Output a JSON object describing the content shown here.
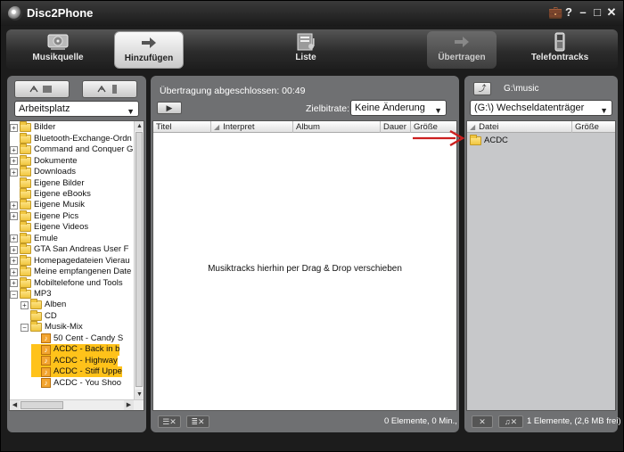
{
  "window": {
    "title": "Disc2Phone",
    "controls": [
      "💼",
      "?",
      "–",
      "□",
      "✕"
    ]
  },
  "toolbar": {
    "tools": [
      {
        "label": "Musikquelle"
      },
      {
        "label": "Hinzufügen"
      },
      {
        "label": "Liste"
      },
      {
        "label": "Übertragen"
      },
      {
        "label": "Telefontracks"
      }
    ]
  },
  "left": {
    "source_select": "Arbeitsplatz",
    "tree": [
      {
        "label": "Bilder",
        "type": "folder",
        "expander": "+",
        "depth": 0,
        "selected": false
      },
      {
        "label": "Bluetooth-Exchange-Ordn",
        "type": "folder",
        "expander": "",
        "depth": 0,
        "selected": false
      },
      {
        "label": "Command and Conquer G",
        "type": "folder",
        "expander": "+",
        "depth": 0,
        "selected": false
      },
      {
        "label": "Dokumente",
        "type": "folder",
        "expander": "+",
        "depth": 0,
        "selected": false
      },
      {
        "label": "Downloads",
        "type": "folder",
        "expander": "+",
        "depth": 0,
        "selected": false
      },
      {
        "label": "Eigene Bilder",
        "type": "folder",
        "expander": "",
        "depth": 0,
        "selected": false
      },
      {
        "label": "Eigene eBooks",
        "type": "folder",
        "expander": "",
        "depth": 0,
        "selected": false
      },
      {
        "label": "Eigene Musik",
        "type": "folder",
        "expander": "+",
        "depth": 0,
        "selected": false
      },
      {
        "label": "Eigene Pics",
        "type": "folder",
        "expander": "+",
        "depth": 0,
        "selected": false
      },
      {
        "label": "Eigene Videos",
        "type": "folder",
        "expander": "",
        "depth": 0,
        "selected": false
      },
      {
        "label": "Emule",
        "type": "folder",
        "expander": "+",
        "depth": 0,
        "selected": false
      },
      {
        "label": "GTA San Andreas User F",
        "type": "folder",
        "expander": "+",
        "depth": 0,
        "selected": false
      },
      {
        "label": "Homepagedateien Vierau",
        "type": "folder",
        "expander": "+",
        "depth": 0,
        "selected": false
      },
      {
        "label": "Meine empfangenen Date",
        "type": "folder",
        "expander": "+",
        "depth": 0,
        "selected": false
      },
      {
        "label": "Mobiltelefone und Tools",
        "type": "folder",
        "expander": "+",
        "depth": 0,
        "selected": false
      },
      {
        "label": "MP3",
        "type": "folder",
        "expander": "−",
        "depth": 0,
        "selected": false
      },
      {
        "label": "Alben",
        "type": "folder",
        "expander": "+",
        "depth": 1,
        "selected": false
      },
      {
        "label": "CD",
        "type": "folder",
        "expander": "",
        "depth": 1,
        "selected": false
      },
      {
        "label": "Musik-Mix",
        "type": "folder",
        "expander": "−",
        "depth": 1,
        "selected": false
      },
      {
        "label": "50 Cent - Candy S",
        "type": "music",
        "expander": "",
        "depth": 2,
        "selected": false
      },
      {
        "label": "ACDC - Back in b",
        "type": "music",
        "expander": "",
        "depth": 2,
        "selected": true
      },
      {
        "label": "ACDC - Highway",
        "type": "music",
        "expander": "",
        "depth": 2,
        "selected": true
      },
      {
        "label": "ACDC - Stiff Uppe",
        "type": "music",
        "expander": "",
        "depth": 2,
        "selected": true
      },
      {
        "label": "ACDC - You Shoo",
        "type": "music",
        "expander": "",
        "depth": 2,
        "selected": false
      }
    ]
  },
  "middle": {
    "status": "Übertragung abgeschlossen: 00:49",
    "bitrate_label": "Zielbitrate:",
    "bitrate_value": "Keine Änderung",
    "columns": [
      "Titel",
      "Interpret",
      "Album",
      "Dauer",
      "Größe"
    ],
    "empty_hint": "Musiktracks hierhin per Drag & Drop verschieben",
    "count": "0 Elemente, 0 Min.,"
  },
  "right": {
    "path": "G:\\music",
    "drive_select": "(G:\\) Wechseldatenträger",
    "columns": [
      "Datei",
      "Größe"
    ],
    "files": [
      {
        "name": "ACDC"
      }
    ],
    "count": "1 Elemente,  (2,6 MB frei)"
  },
  "colors": {
    "selection": "#ffc21a",
    "annotation_arrow": "#cc1f1f",
    "panel": "#6f7072"
  }
}
